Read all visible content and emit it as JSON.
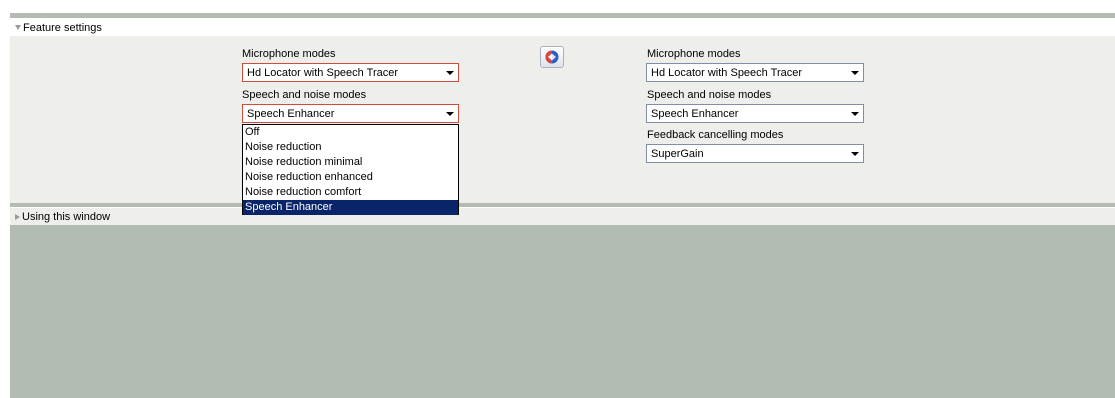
{
  "sections": {
    "feature_settings": "Feature settings",
    "using_window": "Using this window"
  },
  "left": {
    "mic_label": "Microphone modes",
    "mic_value": "Hd Locator with Speech Tracer",
    "speech_label": "Speech and noise modes",
    "speech_value": "Speech Enhancer",
    "speech_options": [
      "Off",
      "Noise reduction",
      "Noise reduction minimal",
      "Noise reduction enhanced",
      "Noise reduction comfort",
      "Speech Enhancer"
    ]
  },
  "right": {
    "mic_label": "Microphone modes",
    "mic_value": "Hd Locator with Speech Tracer",
    "speech_label": "Speech and noise modes",
    "speech_value": "Speech Enhancer",
    "feedback_label": "Feedback cancelling modes",
    "feedback_value": "SuperGain"
  },
  "icons": {
    "section_expanded": "triangle-down-icon",
    "section_collapsed": "triangle-right-icon",
    "sync": "sync-arrows-icon",
    "dropdown": "chevron-down-icon"
  },
  "colors": {
    "panel_bg": "#eeeeea",
    "frame": "#b3bcb3",
    "active_border": "#d24a3e",
    "selection": "#0a246a"
  }
}
